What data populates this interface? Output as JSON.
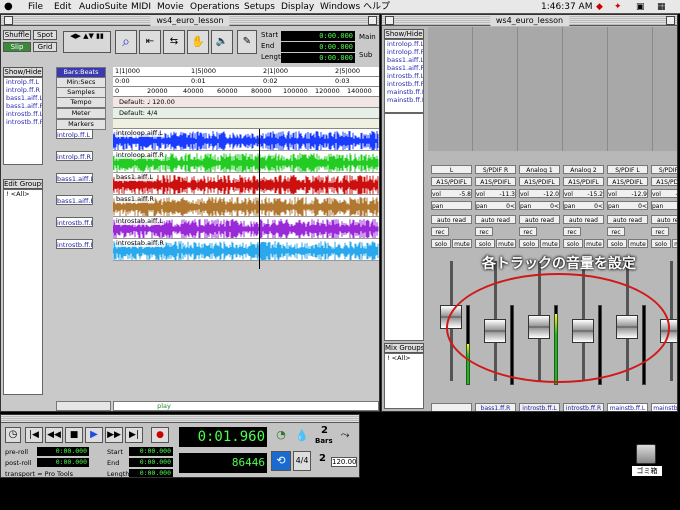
{
  "menubar": {
    "items": [
      "File",
      "Edit",
      "AudioSuite",
      "MIDI",
      "Movie",
      "Operations",
      "Setups",
      "Display",
      "Windows",
      "ヘルプ"
    ],
    "clock": "1:46:37 AM"
  },
  "edit_window": {
    "title": "ws4_euro_lesson",
    "modes": {
      "shuffle": "Shuffle",
      "spot": "Spot",
      "slip": "Slip",
      "grid": "Grid"
    },
    "counters": {
      "start_label": "Start",
      "end_label": "End",
      "length_label": "Length",
      "start": "0:00.000",
      "end": "0:00.000",
      "length": "0:00.000"
    },
    "main_label": "Main",
    "sub_label": "Sub",
    "show_hide": "Show/Hide",
    "tracks_list": [
      "introlp.ff.L",
      "introlp.ff.R",
      "bass1.aiff.L",
      "bass1.aiff.R",
      "introstb.ff.L",
      "introstb.ff.R"
    ],
    "edit_groups": "Edit Groups",
    "all_group": "! <All>",
    "rulers": {
      "bars": "Bars:Beats",
      "min": "Min:Secs",
      "samples": "Samples",
      "tempo": "Tempo",
      "meter": "Meter",
      "markers": "Markers"
    },
    "bar_ticks": [
      "1|1|000",
      "1|5|000",
      "2|1|000",
      "2|5|000"
    ],
    "min_ticks": [
      "0:00",
      "0:01",
      "0:02",
      "0:03"
    ],
    "sample_ticks": [
      "0",
      "20000",
      "40000",
      "60000",
      "80000",
      "100000",
      "120000",
      "140000"
    ],
    "tempo_value": "Default: ♩ 120.00",
    "meter_value": "Default: 4/4",
    "track_names": [
      "introlp.ff.L",
      "introlp.ff.R",
      "bass1.aiff.L",
      "bass1.aiff.R",
      "introstb.ff.L",
      "introstb.ff.R"
    ],
    "clip_names": [
      "introloop.aiff.L",
      "introloop.aiff.R",
      "bass1.aiff.L",
      "bass1.aiff.R",
      "introstab.aiff.L",
      "introstab.aiff.R"
    ],
    "clip_colors": [
      "#1a3cff",
      "#22cc22",
      "#cc1010",
      "#b07830",
      "#9a2ad8",
      "#2aa8ee"
    ],
    "play_label": "play"
  },
  "mix_window": {
    "title": "ws4_euro_lesson",
    "show_hide": "Show/Hide",
    "tracks_list": [
      "introlop.ff.L",
      "introlop.ff.R",
      "bass1.aiff.L",
      "bass1.aiff.R",
      "introstb.ff.L",
      "introstb.ff.R",
      "mainstb.ff.L",
      "mainstb.ff.R"
    ],
    "mix_groups": "Mix Groups",
    "all_group": "! <All>",
    "annotation": "各トラックの音量を設定",
    "strips": [
      {
        "input": "L",
        "output": "A1S/PDIFL",
        "vol": "-5.8",
        "pan": "",
        "name": ""
      },
      {
        "input": "S/PDIF R",
        "output": "A1S/PDIFL",
        "vol": "-11.3",
        "pan": "0<",
        "name": "bass1.ff.R"
      },
      {
        "input": "Analog 1",
        "output": "A1S/PDIFL",
        "vol": "-12.0",
        "pan": "0<",
        "name": "introstb.ff.L"
      },
      {
        "input": "Analog 2",
        "output": "A1S/PDIFL",
        "vol": "-15.2",
        "pan": "0<",
        "name": "introstb.ff.R"
      },
      {
        "input": "S/PDIF L",
        "output": "A1S/PDIFL",
        "vol": "-12.9",
        "pan": "0<",
        "name": "mainstb.ff.L"
      },
      {
        "input": "S/PDIF R",
        "output": "A1S/PDIFL",
        "vol": "-13.2",
        "pan": "0<",
        "name": "mainstb.ff.R"
      }
    ],
    "auto_label": "auto read",
    "rec_label": "rec",
    "solo_label": "solo",
    "mute_label": "mute",
    "vol_label": "vol",
    "pan_label": "pan"
  },
  "transport": {
    "counter": "0:01.960",
    "samples": "86446",
    "preroll_label": "pre-roll",
    "postroll_label": "post-roll",
    "preroll": "0:00.000",
    "postroll": "0:00.000",
    "start_label": "Start",
    "end_label": "End",
    "length_label": "Length",
    "start": "0:00.000",
    "end": "0:00.000",
    "length": "0:00.000",
    "transport_label": "transport = Pro Tools",
    "bars_value": "2",
    "bars_label": "Bars",
    "click_value": "2",
    "tempo": "120.00"
  },
  "desktop": {
    "trash_label": "ゴミ箱"
  }
}
